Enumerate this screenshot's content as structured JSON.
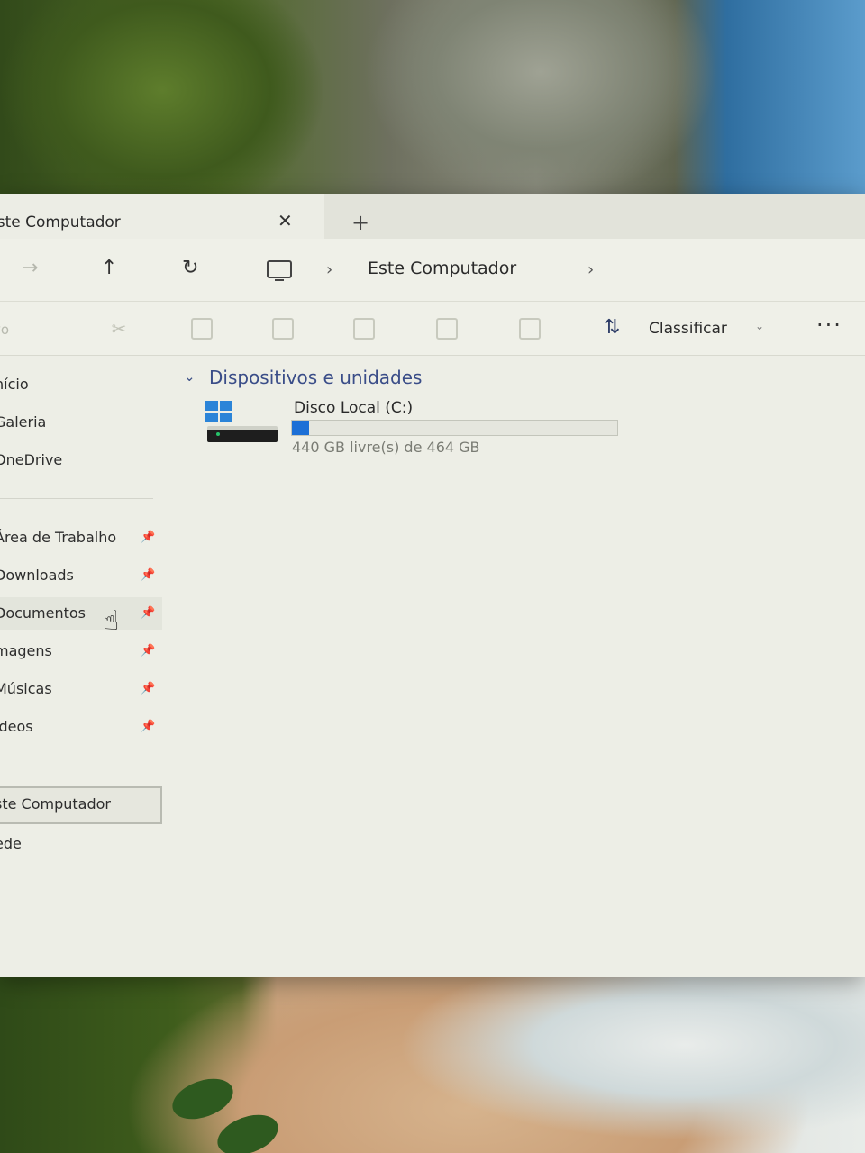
{
  "window": {
    "tab_title": "Este Computador",
    "tab_close_glyph": "✕",
    "new_tab_glyph": "+"
  },
  "navbar": {
    "forward_glyph": "→",
    "up_glyph": "↑",
    "refresh_glyph": "↻",
    "breadcrumb_sep": "›",
    "breadcrumb_current": "Este Computador"
  },
  "commandbar": {
    "new_label": "vo",
    "sort_glyph": "⇅",
    "sort_label": "Classificar",
    "more_glyph": "···"
  },
  "sidebar": {
    "items": [
      {
        "label": "nício"
      },
      {
        "label": "Galeria"
      },
      {
        "label": "OneDrive"
      }
    ],
    "pinned": [
      {
        "label": "Área de Trabalho"
      },
      {
        "label": "Downloads"
      },
      {
        "label": "Documentos"
      },
      {
        "label": "magens"
      },
      {
        "label": "Músicas"
      },
      {
        "label": "ídeos"
      }
    ],
    "bottom": [
      {
        "label": "ste Computador"
      },
      {
        "label": "ede"
      }
    ]
  },
  "content": {
    "group_title": "Dispositivos e unidades",
    "drives": [
      {
        "name": "Disco Local (C:)",
        "free_text": "440 GB livre(s) de 464 GB",
        "used_fraction": 0.052
      }
    ]
  },
  "colors": {
    "accent": "#1c6fd6",
    "group_title": "#3a4d88",
    "window_bg": "#edeee6"
  }
}
